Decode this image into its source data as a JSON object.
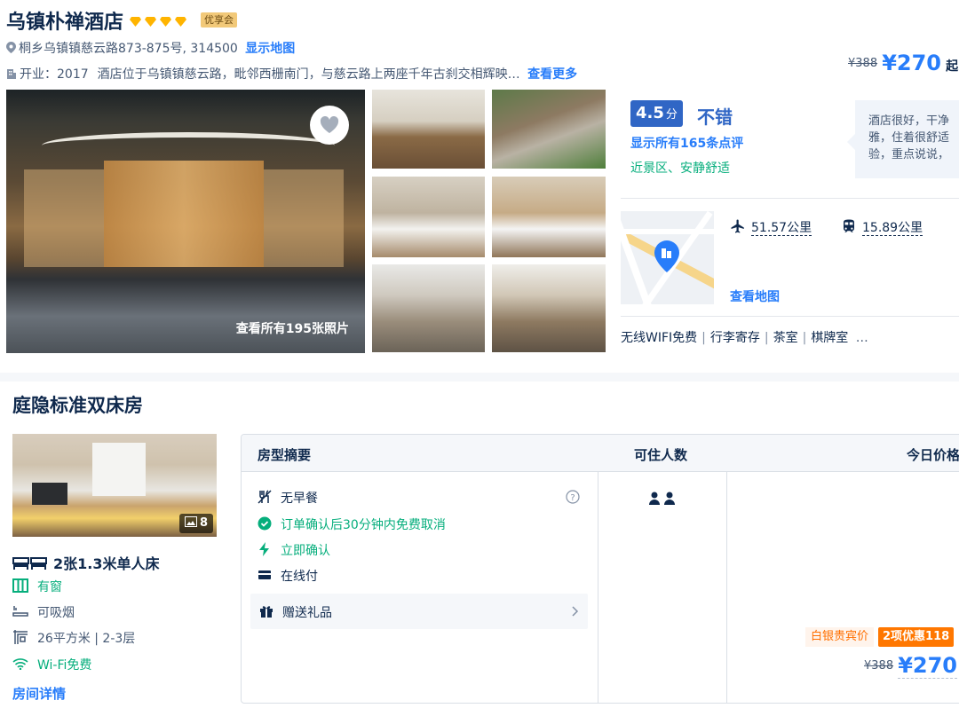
{
  "hotel": {
    "name": "乌镇朴禅酒店",
    "member_badge": "优享会",
    "address": "桐乡乌镇镇慈云路873-875号, 314500",
    "show_map": "显示地图",
    "intro_prefix": "开业：2017",
    "intro": "酒店位于乌镇镇慈云路，毗邻西栅南门，与慈云路上两座千年古刹交相辉映…",
    "see_more": "查看更多",
    "photos_label": "查看所有195张照片",
    "accent_gold": "#ffb400",
    "accent_blue": "#287dfa"
  },
  "price_top": {
    "original": "¥388",
    "price": "¥270",
    "suffix": "起"
  },
  "rating": {
    "score": "4.5",
    "unit": "分",
    "level": "不错",
    "reviews_link": "显示所有165条点评",
    "tags": "近景区、安静舒适",
    "review_line1": "酒店很好，干净",
    "review_line2": "雅，住着很舒适",
    "review_line3": "验，重点说说，"
  },
  "location": {
    "airport_distance": "51.57公里",
    "station_distance": "15.89公里",
    "map_link": "查看地图"
  },
  "facilities": [
    "无线WIFI免费",
    "行李寄存",
    "茶室",
    "棋牌室"
  ],
  "facilities_more": "…",
  "room": {
    "title": "庭隐标准双床房",
    "photo_count": "8",
    "bed": "2张1.3米单人床",
    "window": "有窗",
    "smoking": "可吸烟",
    "area_floor": "26平方米 | 2-3层",
    "wifi": "Wi-Fi免费",
    "details_link": "房间详情"
  },
  "table": {
    "col_summary": "房型摘要",
    "col_guests": "可住人数",
    "col_price": "今日价格",
    "breakfast": "无早餐",
    "cancel": "订单确认后30分钟内免费取消",
    "instant": "立即确认",
    "pay": "在线付",
    "gift": "赠送礼品",
    "member_price": "白银贵宾价",
    "discount_badge": "2项优惠118",
    "original": "¥388",
    "price": "¥270"
  }
}
